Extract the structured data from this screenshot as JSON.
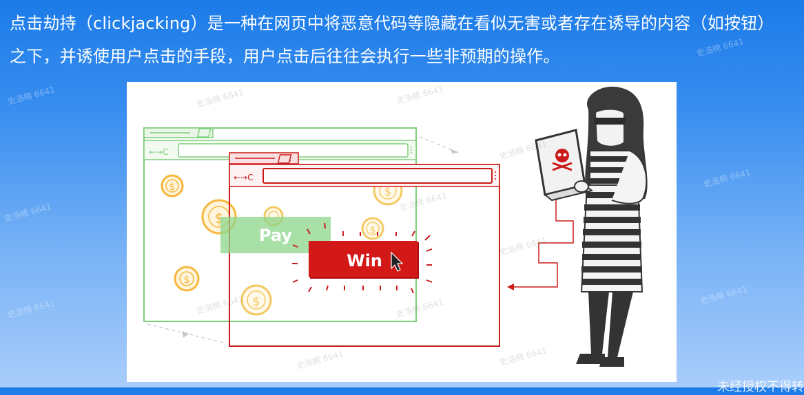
{
  "intro": {
    "line1": "点击劫持（clickjacking）是一种在网页中将恶意代码等隐藏在看似无害或者存在诱导的内容（如按钮）",
    "line2": "之下，并诱使用户点击的手段，用户点击后往往会执行一些非预期的操作。"
  },
  "illustration": {
    "pay_label": "Pay",
    "win_label": "Win",
    "nav_symbol": "←→C",
    "close_symbol": "×",
    "coin_symbol": "$"
  },
  "watermark": "史浩楠 6641",
  "footer_notice": "未经授权不得转",
  "colors": {
    "green": "#7fce7b",
    "red": "#cc1a1a",
    "coin": "#f5b83c"
  }
}
